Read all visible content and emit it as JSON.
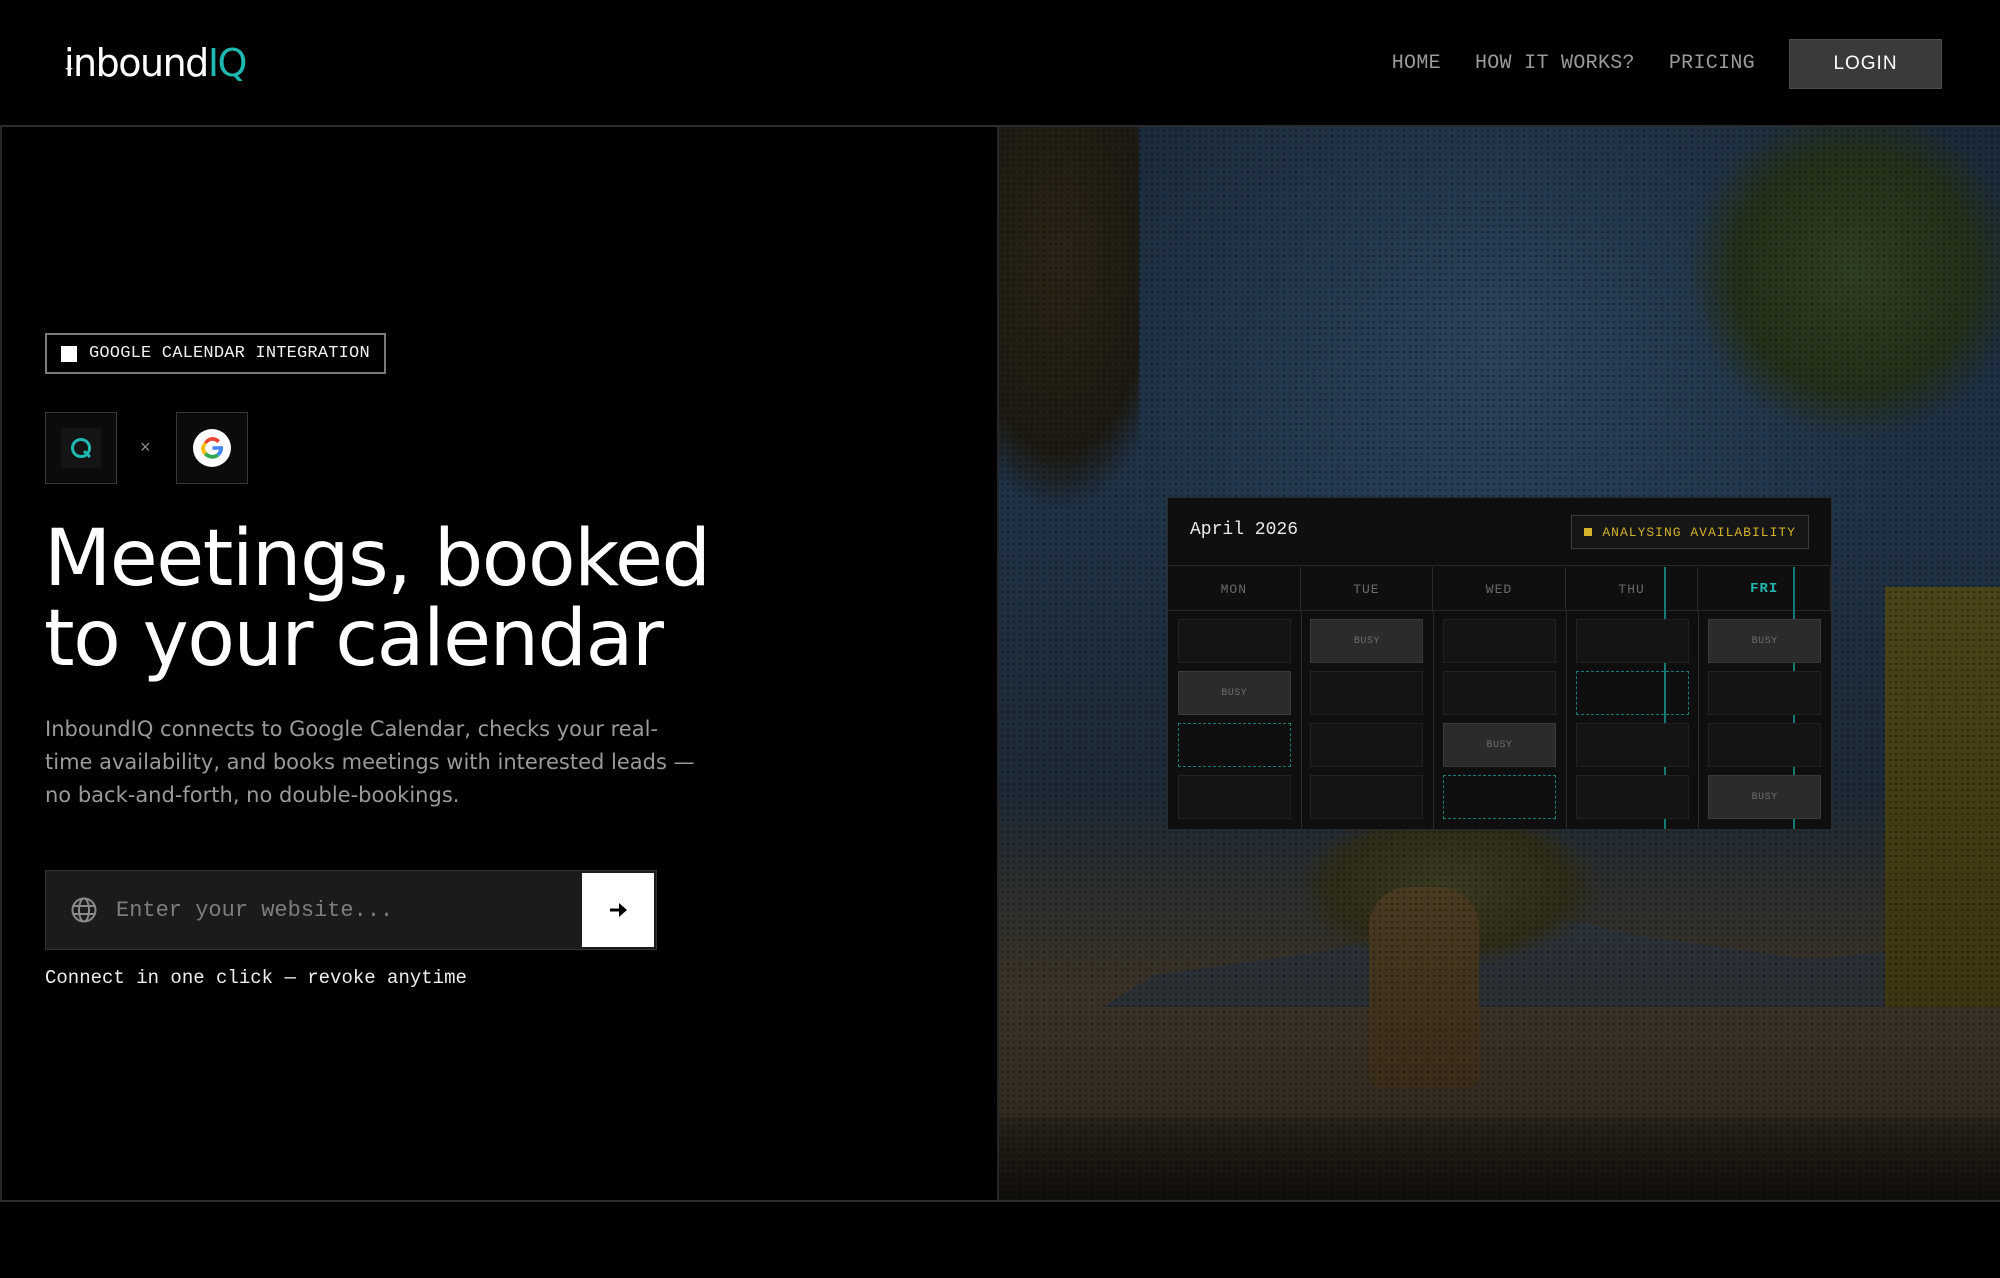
{
  "brand": {
    "logo_main": "inbound",
    "logo_accent": "IQ"
  },
  "nav": {
    "links": [
      "HOME",
      "HOW IT WORKS?",
      "PRICING"
    ],
    "login_label": "LOGIN"
  },
  "hero": {
    "badge_label": "GOOGLE CALENDAR INTEGRATION",
    "separator": "×",
    "headline_line1": "Meetings, booked",
    "headline_line2": "to your calendar",
    "subcopy": "InboundIQ connects to Google Calendar, checks your real-time availability, and books meetings with interested leads — no back-and-forth, no double-bookings.",
    "input_placeholder": "Enter your website...",
    "helper_text": "Connect in one click — revoke anytime"
  },
  "calendar": {
    "month": "April 2026",
    "status": "ANALYSING AVAILABILITY",
    "days": [
      "MON",
      "TUE",
      "WED",
      "THU",
      "FRI"
    ],
    "today": "FRI",
    "slots": [
      [
        "empty",
        "busy",
        "open",
        "empty"
      ],
      [
        "busy",
        "empty",
        "empty",
        "empty"
      ],
      [
        "empty",
        "empty",
        "busy",
        "open"
      ],
      [
        "empty",
        "open",
        "empty",
        "empty"
      ],
      [
        "busy",
        "empty",
        "empty",
        "busy"
      ]
    ],
    "busy_label": "BUSY"
  },
  "colors": {
    "accent": "#1fb8b0",
    "status": "#d4b22a"
  }
}
